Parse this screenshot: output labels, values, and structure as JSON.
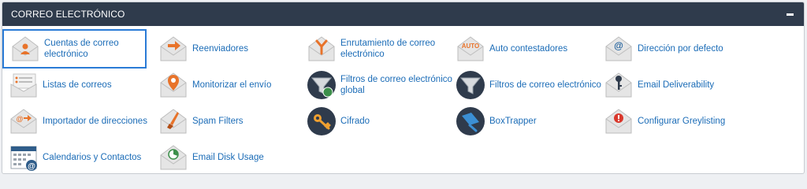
{
  "section": {
    "title": "CORREO ELECTRÓNICO",
    "collapse_icon": "minus-icon"
  },
  "items": [
    {
      "label": "Cuentas de correo electrónico",
      "icon": "email-accounts-icon"
    },
    {
      "label": "Reenviadores",
      "icon": "forwarders-icon"
    },
    {
      "label": "Enrutamiento de correo electrónico",
      "icon": "email-routing-icon"
    },
    {
      "label": "Auto contestadores",
      "icon": "autoresponders-icon"
    },
    {
      "label": "Dirección por defecto",
      "icon": "default-address-icon"
    },
    {
      "label": "Listas de correos",
      "icon": "mailing-lists-icon"
    },
    {
      "label": "Monitorizar el envío",
      "icon": "track-delivery-icon"
    },
    {
      "label": "Filtros de correo electrónico global",
      "icon": "global-filters-icon"
    },
    {
      "label": "Filtros de correo electrónico",
      "icon": "email-filters-icon"
    },
    {
      "label": "Email Deliverability",
      "icon": "email-deliverability-icon"
    },
    {
      "label": "Importador de direcciones",
      "icon": "address-importer-icon"
    },
    {
      "label": "Spam Filters",
      "icon": "spam-filters-icon"
    },
    {
      "label": "Cifrado",
      "icon": "encryption-key-icon"
    },
    {
      "label": "BoxTrapper",
      "icon": "boxtrapper-icon"
    },
    {
      "label": "Configurar Greylisting",
      "icon": "greylisting-icon"
    },
    {
      "label": "Calendarios y Contactos",
      "icon": "calendars-contacts-icon"
    },
    {
      "label": "Email Disk Usage",
      "icon": "email-disk-usage-icon"
    }
  ],
  "colors": {
    "header_bg": "#2f3b4c",
    "link": "#1b6cb7",
    "selected_border": "#2a7bd6",
    "accent_orange": "#e8732a"
  }
}
